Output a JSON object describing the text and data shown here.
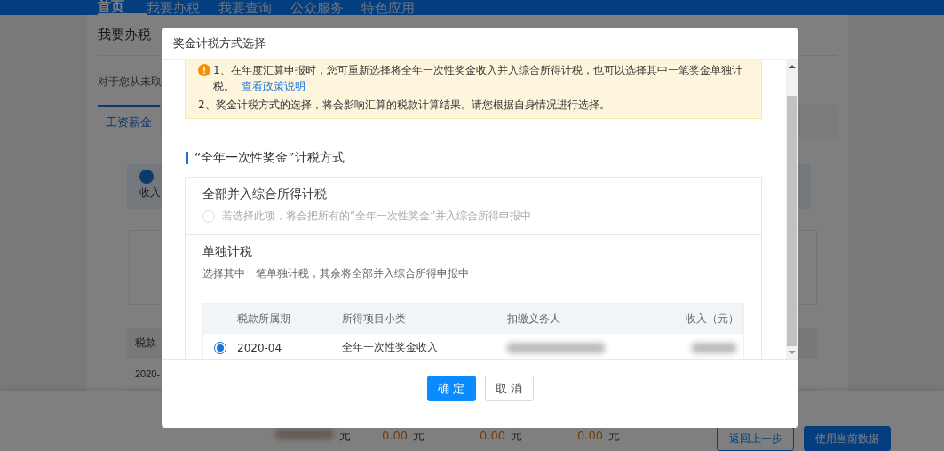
{
  "nav": [
    {
      "label": "首页",
      "selected": true
    },
    {
      "label": "我要办税",
      "selected": false
    },
    {
      "label": "我要查询",
      "selected": false
    },
    {
      "label": "公众服务",
      "selected": false
    },
    {
      "label": "特色应用",
      "selected": false
    }
  ],
  "breadcrumb": "我要办税",
  "intro": "对于您从未取",
  "tabs": [
    {
      "label": "工资薪金",
      "selected": true
    }
  ],
  "info": {
    "text": "收入"
  },
  "background_table": {
    "header": "税款",
    "cell": "2020-"
  },
  "bottom_bar": {
    "amounts": [
      {
        "unit": "元"
      },
      {
        "value": "0.00",
        "unit": "元"
      },
      {
        "value": "0.00",
        "unit": "元"
      },
      {
        "value": "0.00",
        "unit": "元"
      }
    ],
    "buttons": [
      {
        "label": "返回上一步",
        "kind": "outline"
      },
      {
        "label": "使用当前数据",
        "kind": "primary"
      }
    ]
  },
  "dialog": {
    "title": "奖金计税方式选择",
    "notice": {
      "item1": "1、在年度汇算申报时，您可重新选择将全年一次性奖金收入并入综合所得计税，也可以选择其中一笔奖金单独计税。",
      "link": "查看政策说明",
      "item2": "2、奖金计税方式的选择，将会影响汇算的税款计算结果。请您根据自身情况进行选择。"
    },
    "section_title": "“全年一次性奖金”计税方式",
    "options": [
      {
        "kind": "radio",
        "title": "全部并入综合所得计税",
        "description": "若选择此项，将会把所有的“全年一次性奖金”并入综合所得申报中",
        "selected": false
      },
      {
        "kind": "table",
        "title": "单独计税",
        "description": "选择其中一笔单独计税，其余将全部并入综合所得申报中",
        "columns": [
          "税款所属期",
          "所得项目小类",
          "扣缴义务人",
          "收入（元）"
        ],
        "rows": [
          {
            "selected": true,
            "cells": [
              "2020-04",
              "全年一次性奖金收入"
            ]
          }
        ]
      }
    ],
    "buttons": [
      {
        "label": "确 定",
        "kind": "primary"
      },
      {
        "label": "取 消",
        "kind": "outline"
      }
    ]
  }
}
